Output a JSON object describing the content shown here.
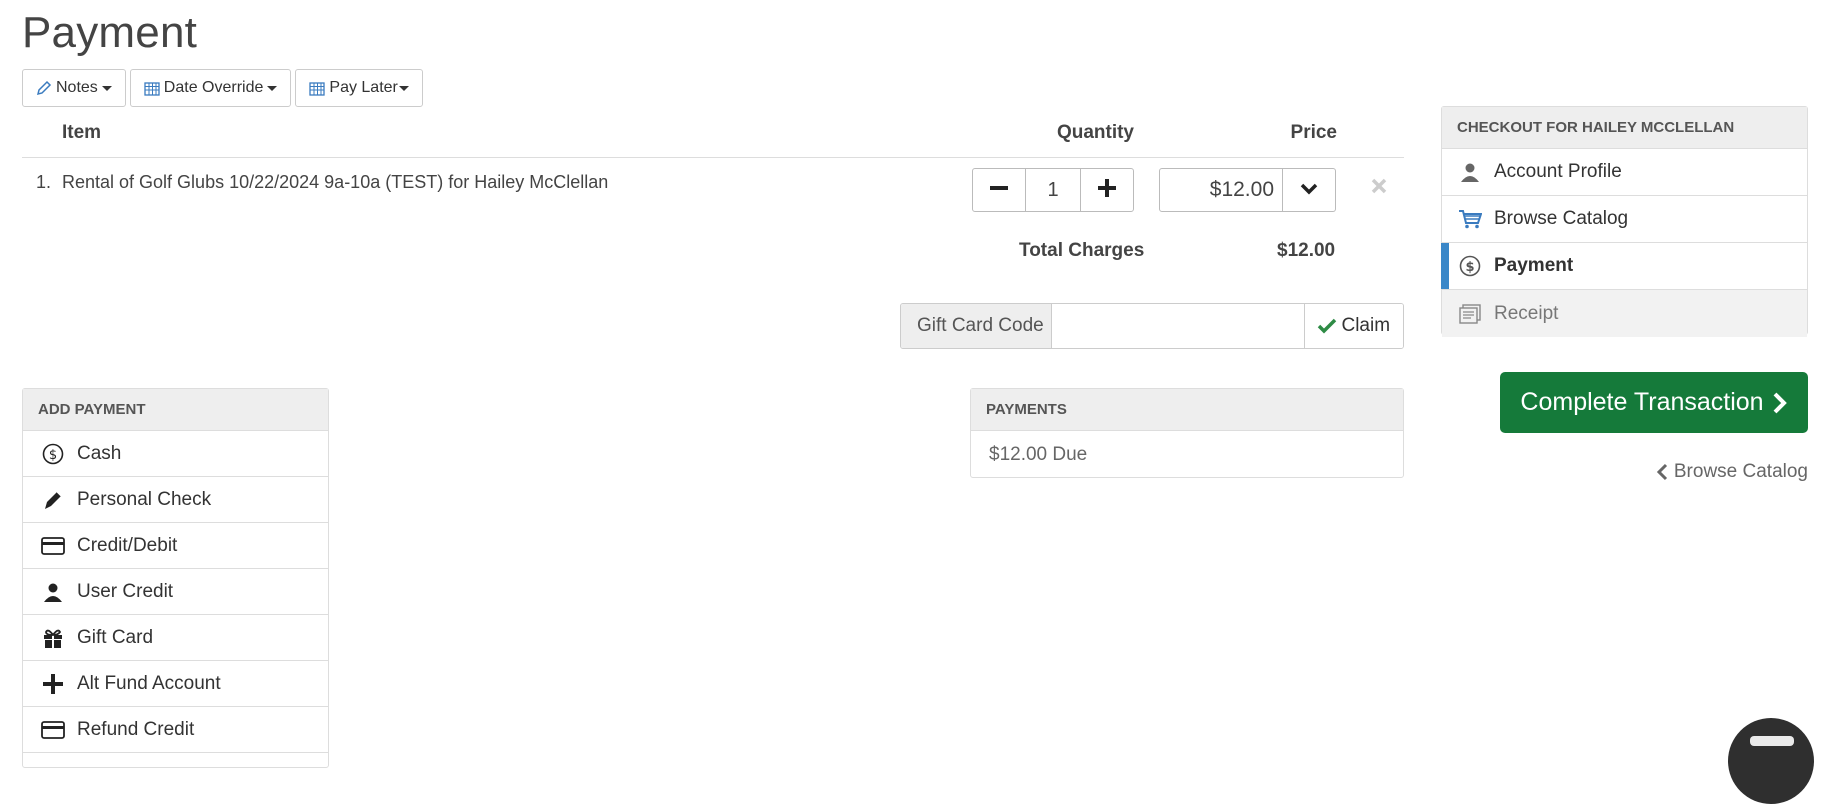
{
  "page": {
    "title": "Payment"
  },
  "toolbar": {
    "notes_label": "Notes",
    "date_override_label": "Date Override",
    "pay_later_label": "Pay Later"
  },
  "cart": {
    "headers": {
      "item": "Item",
      "quantity": "Quantity",
      "price": "Price"
    },
    "items": [
      {
        "num": "1.",
        "name": "Rental of Golf Glubs 10/22/2024 9a-10a (TEST) for Hailey McClellan",
        "quantity": "1",
        "price": "$12.00"
      }
    ],
    "total_label": "Total Charges",
    "total_value": "$12.00"
  },
  "gift_card": {
    "label": "Gift Card Code",
    "value": "",
    "placeholder": "",
    "claim_label": "Claim"
  },
  "add_payment": {
    "heading": "Add Payment",
    "methods": [
      {
        "label": "Cash",
        "icon": "dollar-circle-icon"
      },
      {
        "label": "Personal Check",
        "icon": "pen-icon"
      },
      {
        "label": "Credit/Debit",
        "icon": "credit-card-icon"
      },
      {
        "label": "User Credit",
        "icon": "user-icon"
      },
      {
        "label": "Gift Card",
        "icon": "gift-icon"
      },
      {
        "label": "Alt Fund Account",
        "icon": "plus-icon"
      },
      {
        "label": "Refund Credit",
        "icon": "credit-card-icon"
      }
    ]
  },
  "payments": {
    "heading": "Payments",
    "due": "$12.00 Due"
  },
  "checkout": {
    "heading": "Checkout for Hailey McClellan",
    "steps": [
      {
        "label": "Account Profile",
        "icon": "user-icon",
        "state": "normal"
      },
      {
        "label": "Browse Catalog",
        "icon": "cart-icon",
        "state": "normal"
      },
      {
        "label": "Payment",
        "icon": "dollar-circle-icon",
        "state": "active"
      },
      {
        "label": "Receipt",
        "icon": "receipt-icon",
        "state": "disabled"
      }
    ]
  },
  "actions": {
    "complete_label": "Complete Transaction",
    "back_label": "Browse Catalog"
  },
  "colors": {
    "primary": "#157a3a",
    "active_step": "#3a87c8",
    "link_icon": "#3a7bbf"
  }
}
